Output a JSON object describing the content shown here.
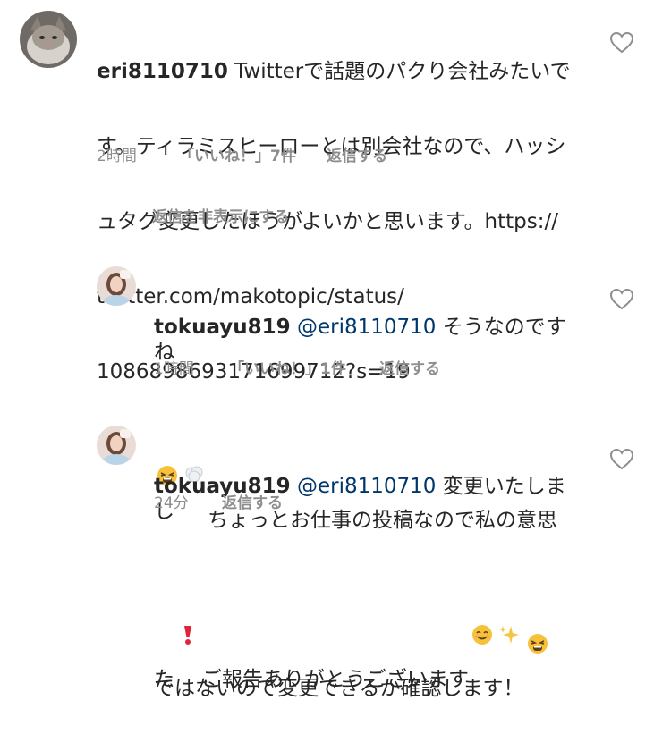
{
  "comments": [
    {
      "username": "eri8110710",
      "text_lines": [
        " Twitterで話題のパクり会社みたいで",
        "す。ティラミスヒーローとは別会社なので、ハッシ",
        "ュタグ変更したほうがよいかと思います。https://",
        "twitter.com/makotopic/status/",
        "1086898693171699712?s=19"
      ],
      "time": "2時間",
      "likes": "「いいね！」7件",
      "reply": "返信する",
      "avatar_icon": "cat-photo-avatar",
      "heart_icon": "heart-outline-icon"
    },
    {
      "username": "tokuayu819",
      "mention": "@eri8110710",
      "text_line1": " そうなのですね",
      "text_line2": "ちょっとお仕事の投稿なので私の意思",
      "text_line3": "ではないので変更できるか確認します！",
      "time": "1時間",
      "likes": "「いいね！」1件",
      "reply": "返信する",
      "emojis": [
        "tired-face-emoji",
        "thought-balloon-emoji",
        "tired-face-emoji"
      ],
      "avatar_icon": "woman-photo-avatar",
      "heart_icon": "heart-outline-icon"
    },
    {
      "username": "tokuayu819",
      "mention": "@eri8110710",
      "text_line1": " 変更いたしまし",
      "text_line2a": "た",
      "text_line2b": "ご報告ありがとうございます",
      "time": "24分",
      "reply": "返信する",
      "emojis": [
        "exclamation-mark-emoji",
        "smiling-face-emoji",
        "sparkles-emoji"
      ],
      "avatar_icon": "woman-photo-avatar",
      "heart_icon": "heart-outline-icon"
    }
  ],
  "hide_replies": "返信を非表示にする",
  "colors": {
    "text": "#262626",
    "muted": "#8e8e8e",
    "mention": "#00376b",
    "divider": "#c7c7c7"
  }
}
